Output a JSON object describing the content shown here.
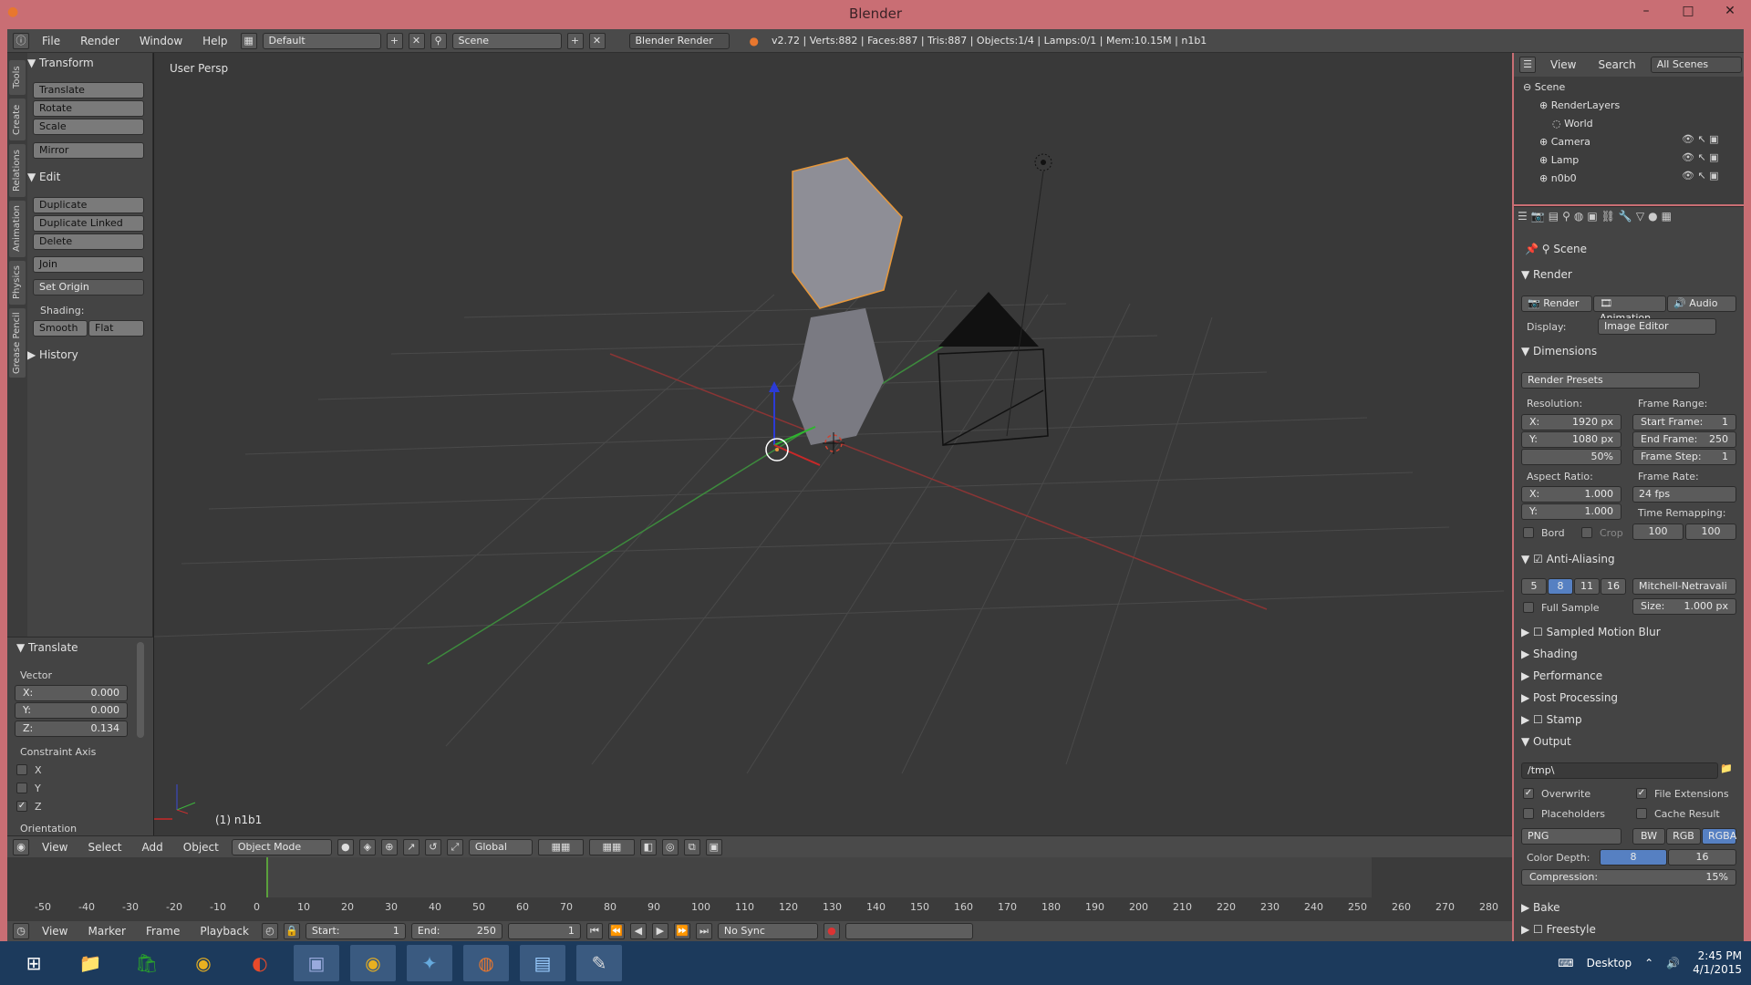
{
  "window": {
    "title": "Blender"
  },
  "infobar": {
    "menus": [
      "File",
      "Render",
      "Window",
      "Help"
    ],
    "layout": "Default",
    "scene": "Scene",
    "engine": "Blender Render",
    "stats": "v2.72 | Verts:882 | Faces:887 | Tris:887 | Objects:1/4 | Lamps:0/1 | Mem:10.15M | n1b1"
  },
  "toolshelf": {
    "tabs": [
      "Tools",
      "Create",
      "Relations",
      "Animation",
      "Physics",
      "Grease Pencil"
    ],
    "transform": {
      "title": "Transform",
      "buttons": [
        "Translate",
        "Rotate",
        "Scale",
        "Mirror"
      ]
    },
    "edit": {
      "title": "Edit",
      "buttons": [
        "Duplicate",
        "Duplicate Linked",
        "Delete",
        "Join"
      ],
      "set_origin": "Set Origin",
      "shading_label": "Shading:",
      "smooth": "Smooth",
      "flat": "Flat"
    },
    "history": {
      "title": "History"
    }
  },
  "operator": {
    "title": "Translate",
    "vector_label": "Vector",
    "x": "X:",
    "xv": "0.000",
    "y": "Y:",
    "yv": "0.000",
    "z": "Z:",
    "zv": "0.134",
    "constraint_label": "Constraint Axis",
    "cx": "X",
    "cy": "Y",
    "cz": "Z",
    "orientation_label": "Orientation"
  },
  "viewport": {
    "label": "User Persp",
    "object_label": "(1) n1b1"
  },
  "vpheader": {
    "menus": [
      "View",
      "Select",
      "Add",
      "Object"
    ],
    "mode": "Object Mode",
    "orientation": "Global"
  },
  "timeline": {
    "ticks": [
      "-50",
      "-40",
      "-30",
      "-20",
      "-10",
      "0",
      "10",
      "20",
      "30",
      "40",
      "50",
      "60",
      "70",
      "80",
      "90",
      "100",
      "110",
      "120",
      "130",
      "140",
      "150",
      "160",
      "170",
      "180",
      "190",
      "200",
      "210",
      "220",
      "230",
      "240",
      "250",
      "260",
      "270",
      "280"
    ],
    "menus": [
      "View",
      "Marker",
      "Frame",
      "Playback"
    ],
    "start": "Start:",
    "start_v": "1",
    "end": "End:",
    "end_v": "250",
    "current": "1",
    "sync": "No Sync"
  },
  "outliner": {
    "menus": [
      "View",
      "Search"
    ],
    "filter": "All Scenes",
    "items": [
      "Scene",
      "RenderLayers",
      "World",
      "Camera",
      "Lamp",
      "n0b0"
    ]
  },
  "properties": {
    "breadcrumb": "Scene",
    "render": {
      "title": "Render",
      "render_btn": "Render",
      "animation_btn": "Animation",
      "audio_btn": "Audio",
      "display_label": "Display:",
      "display": "Image Editor"
    },
    "dimensions": {
      "title": "Dimensions",
      "presets": "Render Presets",
      "resolution_label": "Resolution:",
      "x_label": "X:",
      "x": "1920 px",
      "y_label": "Y:",
      "y": "1080 px",
      "pct": "50%",
      "frame_range_label": "Frame Range:",
      "start_label": "Start Frame:",
      "start": "1",
      "end_label": "End Frame:",
      "end": "250",
      "step_label": "Frame Step:",
      "step": "1",
      "aspect_label": "Aspect Ratio:",
      "ax": "1.000",
      "ay": "1.000",
      "fps_label": "Frame Rate:",
      "fps": "24 fps",
      "remap_label": "Time Remapping:",
      "remap_old": "100",
      "remap_new": "100",
      "bord": "Bord",
      "crop": "Crop"
    },
    "aa": {
      "title": "Anti-Aliasing",
      "samples": [
        "5",
        "8",
        "11",
        "16"
      ],
      "filter": "Mitchell-Netravali",
      "full_sample": "Full Sample",
      "size_label": "Size:",
      "size": "1.000 px"
    },
    "collapsed": [
      "Sampled Motion Blur",
      "Shading",
      "Performance",
      "Post Processing",
      "Stamp"
    ],
    "output": {
      "title": "Output",
      "path": "/tmp\\",
      "overwrite": "Overwrite",
      "file_ext": "File Extensions",
      "placeholders": "Placeholders",
      "cache": "Cache Result",
      "format": "PNG",
      "bw": "BW",
      "rgb": "RGB",
      "rgba": "RGBA",
      "depth_label": "Color Depth:",
      "d8": "8",
      "d16": "16",
      "compression_label": "Compression:",
      "compression": "15%"
    },
    "bottom": [
      "Bake",
      "Freestyle"
    ]
  },
  "taskbar": {
    "desktop": "Desktop",
    "time": "2:45 PM",
    "date": "4/1/2015"
  }
}
